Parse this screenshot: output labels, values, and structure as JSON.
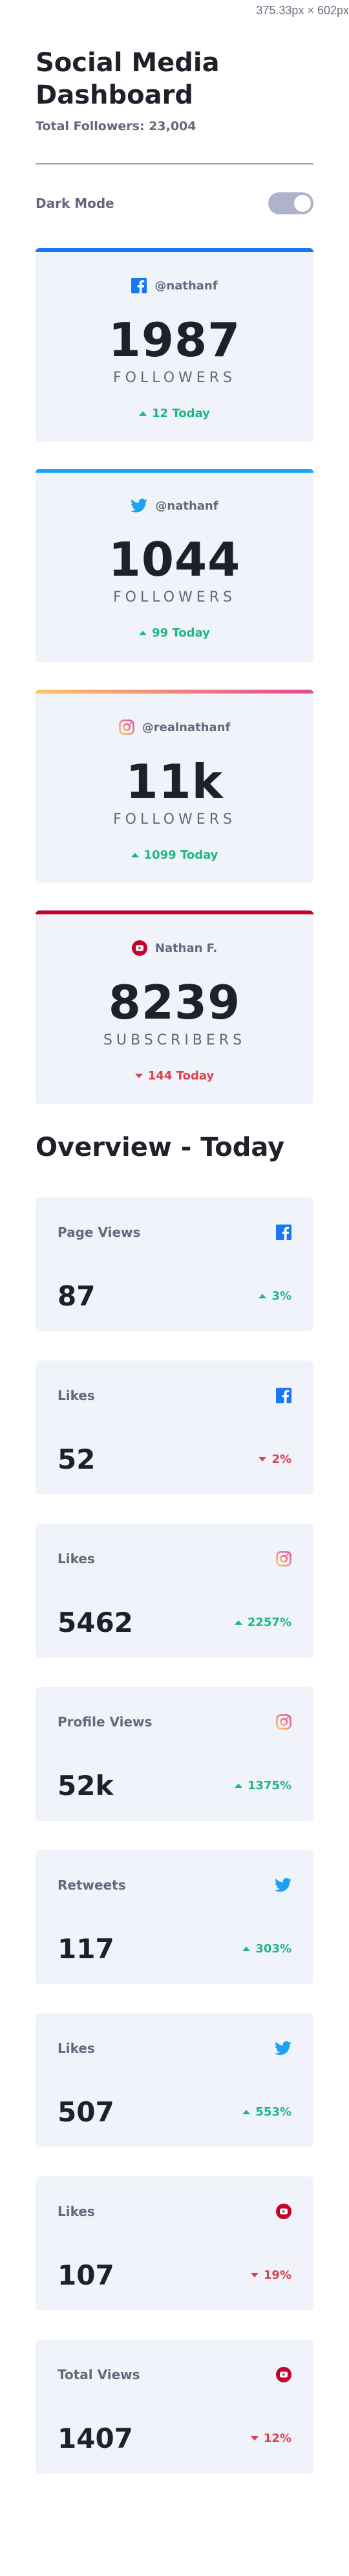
{
  "dimension_label": "375.33px × 602px",
  "header": {
    "title": "Social Media Dashboard",
    "total_followers": "Total Followers: 23,004",
    "dark_mode_label": "Dark Mode"
  },
  "colors": {
    "facebook": "#1877f2",
    "twitter": "#1da1f2",
    "instagram_gradient": [
      "#fdc468",
      "#df4996"
    ],
    "youtube": "#c4032a",
    "up": "#1eb589",
    "down": "#dc414c"
  },
  "summary_cards": [
    {
      "network": "facebook",
      "icon": "facebook-icon",
      "handle": "@nathanf",
      "value": "1987",
      "unit": "FOLLOWERS",
      "change": "12 Today",
      "direction": "up"
    },
    {
      "network": "twitter",
      "icon": "twitter-icon",
      "handle": "@nathanf",
      "value": "1044",
      "unit": "FOLLOWERS",
      "change": "99 Today",
      "direction": "up"
    },
    {
      "network": "instagram",
      "icon": "instagram-icon",
      "handle": "@realnathanf",
      "value": "11k",
      "unit": "FOLLOWERS",
      "change": "1099 Today",
      "direction": "up"
    },
    {
      "network": "youtube",
      "icon": "youtube-icon",
      "handle": "Nathan F.",
      "value": "8239",
      "unit": "SUBSCRIBERS",
      "change": "144 Today",
      "direction": "down"
    }
  ],
  "overview": {
    "title": "Overview - Today",
    "items": [
      {
        "label": "Page Views",
        "network": "facebook",
        "value": "87",
        "change": "3%",
        "direction": "up"
      },
      {
        "label": "Likes",
        "network": "facebook",
        "value": "52",
        "change": "2%",
        "direction": "down"
      },
      {
        "label": "Likes",
        "network": "instagram",
        "value": "5462",
        "change": "2257%",
        "direction": "up"
      },
      {
        "label": "Profile Views",
        "network": "instagram",
        "value": "52k",
        "change": "1375%",
        "direction": "up"
      },
      {
        "label": "Retweets",
        "network": "twitter",
        "value": "117",
        "change": "303%",
        "direction": "up"
      },
      {
        "label": "Likes",
        "network": "twitter",
        "value": "507",
        "change": "553%",
        "direction": "up"
      },
      {
        "label": "Likes",
        "network": "youtube",
        "value": "107",
        "change": "19%",
        "direction": "down"
      },
      {
        "label": "Total Views",
        "network": "youtube",
        "value": "1407",
        "change": "12%",
        "direction": "down"
      }
    ]
  }
}
